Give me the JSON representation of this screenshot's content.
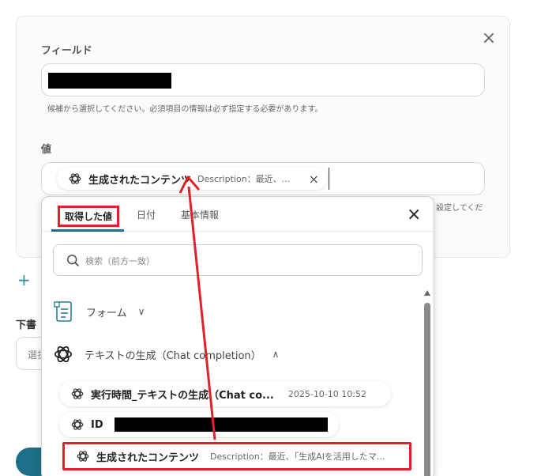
{
  "form": {
    "field_label": "フィールド",
    "field_help": "候補から選択してください。必須項目の情報は必ず指定する必要があります。",
    "value_label": "値",
    "value_help_truncated": "設定してくだ",
    "close_icon": "×"
  },
  "chip": {
    "title": "生成されたコンテンツ",
    "description": "Description：最近、...",
    "remove_icon": "×"
  },
  "sidebar": {
    "plus": "+",
    "draft_label": "下書",
    "select_text": "選択"
  },
  "dropdown": {
    "tabs": [
      {
        "label": "取得した値",
        "active": true
      },
      {
        "label": "日付",
        "active": false
      },
      {
        "label": "基本情報",
        "active": false
      }
    ],
    "close_icon": "×",
    "search_placeholder": "検索（前方一致）",
    "groups": [
      {
        "label": "フォーム",
        "expanded": false,
        "icon": "form-icon"
      },
      {
        "label": "テキストの生成（Chat completion）",
        "expanded": true,
        "icon": "openai-icon"
      }
    ],
    "items": [
      {
        "title": "実行時間_テキストの生成（Chat co...",
        "meta": "2025-10-10 10:52"
      },
      {
        "title": "ID",
        "meta": ""
      },
      {
        "title": "生成されたコンテンツ",
        "meta": "Description：最近、「生成AIを活用したマ..."
      }
    ]
  },
  "colors": {
    "highlight": "#e0202b",
    "accent": "#1f6f86",
    "redact": "#000000"
  }
}
